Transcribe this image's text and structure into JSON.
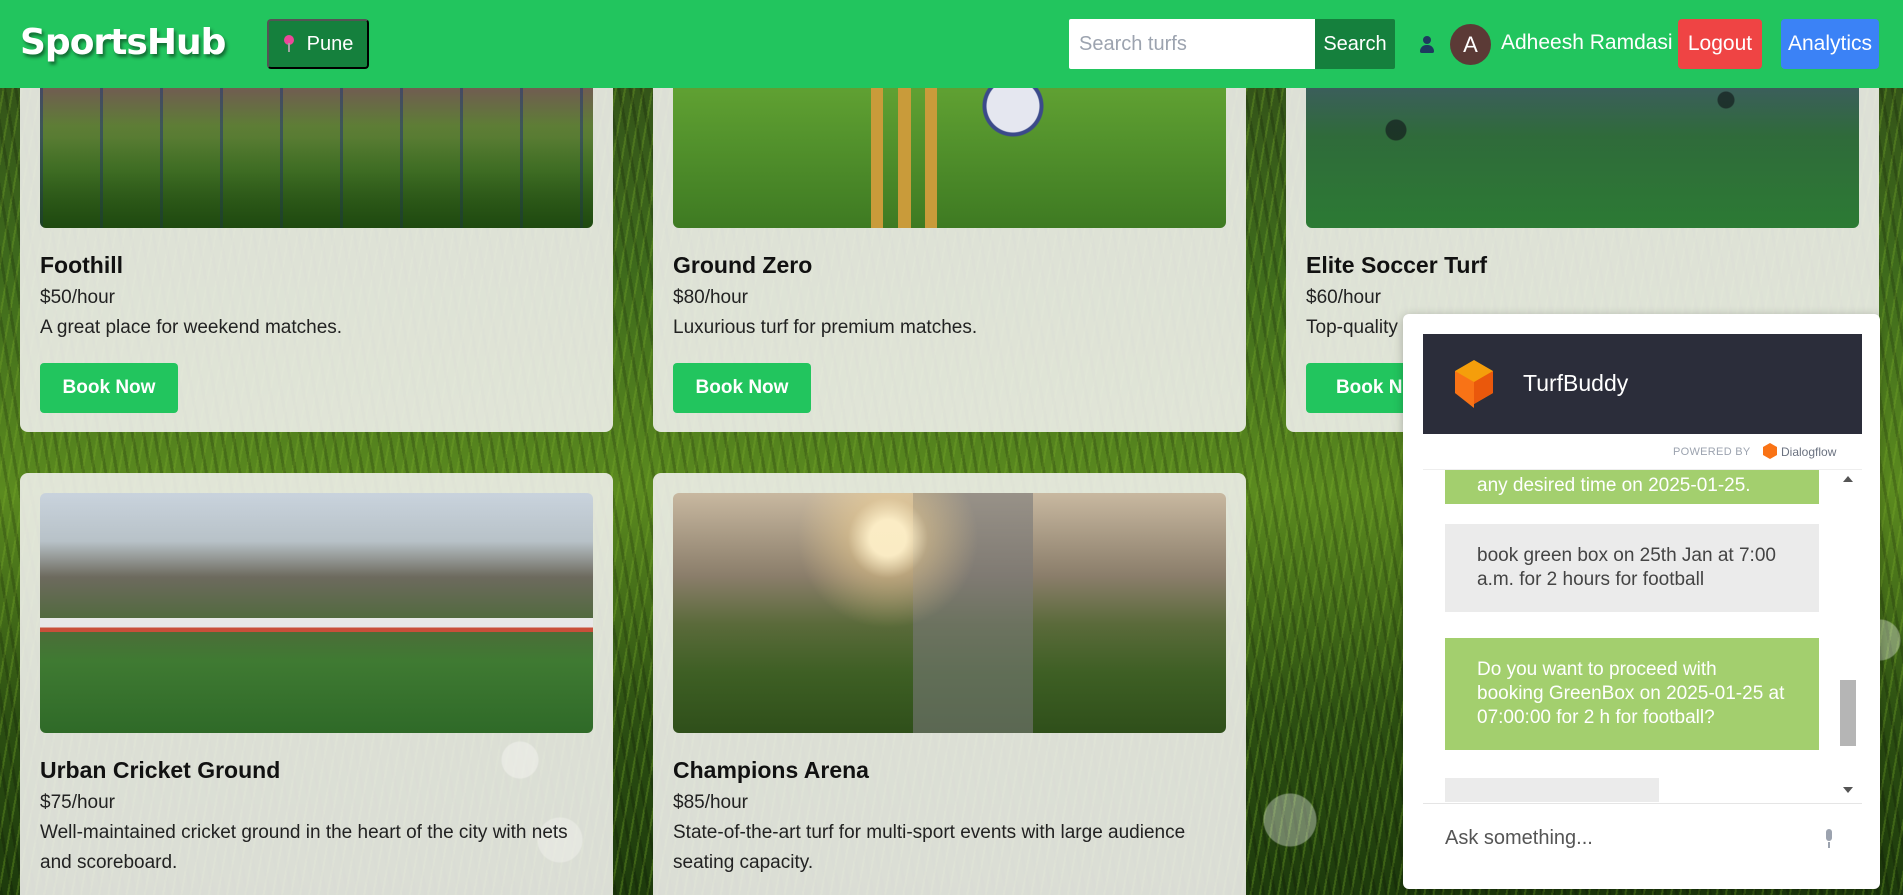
{
  "navbar": {
    "logo": "SportsHub",
    "location": "Pune",
    "search_placeholder": "Search turfs",
    "search_button": "Search",
    "avatar_initial": "A",
    "username": "Adheesh Ramdasi",
    "logout_label": "Logout",
    "analytics_label": "Analytics"
  },
  "turfs": [
    {
      "name": "Foothill",
      "price": "$50/hour",
      "description": "A great place for weekend matches.",
      "button": "Book Now"
    },
    {
      "name": "Ground Zero",
      "price": "$80/hour",
      "description": "Luxurious turf for premium matches.",
      "button": "Book Now"
    },
    {
      "name": "Elite Soccer Turf",
      "price": "$60/hour",
      "description": "Top-quality",
      "button": "Book No"
    },
    {
      "name": "Urban Cricket Ground",
      "price": "$75/hour",
      "description": "Well-maintained cricket ground in the heart of the city with nets and scoreboard."
    },
    {
      "name": "Champions Arena",
      "price": "$85/hour",
      "description": "State-of-the-art turf for multi-sport events with large audience seating capacity."
    }
  ],
  "chat": {
    "title": "TurfBuddy",
    "powered_by": "POWERED BY",
    "provider": "Dialogflow",
    "messages": [
      {
        "from": "bot",
        "text": "any desired time on 2025-01-25."
      },
      {
        "from": "user",
        "text": "book green box on 25th Jan at 7:00 a.m. for 2 hours for football"
      },
      {
        "from": "bot",
        "text": "Do you want to proceed with booking GreenBox on 2025-01-25 at 07:00:00 for 2 h for football?"
      }
    ],
    "input_placeholder": "Ask something..."
  },
  "colors": {
    "brand_green": "#22c55e",
    "dark_green": "#15803d",
    "logout_red": "#ef4444",
    "analytics_blue": "#3b82f6",
    "bot_bubble": "#a3cf6e",
    "chat_header": "#2b2d3a"
  },
  "icons": [
    "location-pin-icon",
    "user-icon",
    "dialogflow-logo-icon",
    "mic-icon",
    "scroll-up-icon",
    "scroll-down-icon"
  ]
}
